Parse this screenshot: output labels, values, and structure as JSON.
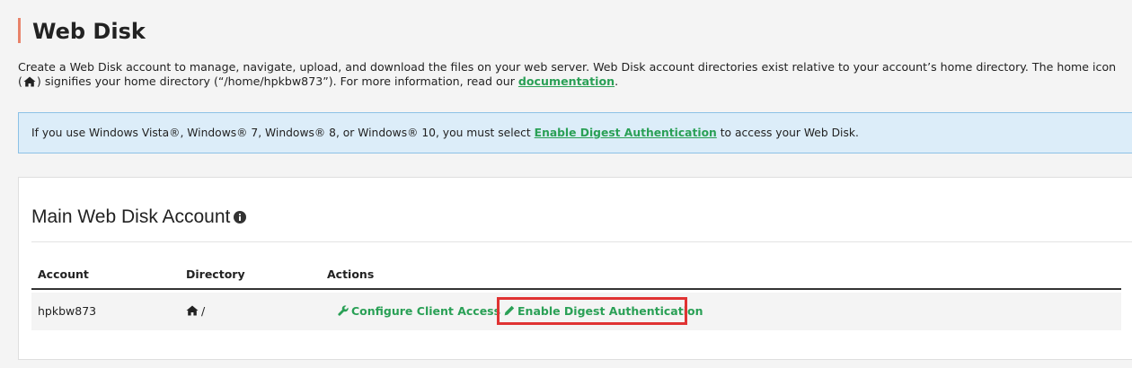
{
  "header": {
    "title": "Web Disk"
  },
  "intro": {
    "text_before_icon": "Create a Web Disk account to manage, navigate, upload, and download the files on your web server. Web Disk account directories exist relative to your account’s home directory. The home icon (",
    "text_after_icon": ") signifies your home directory (“/home/hpkbw873”). For more information, read our ",
    "link_label": "documentation",
    "text_end": "."
  },
  "alert": {
    "text_before": "If you use Windows Vista®, Windows® 7, Windows® 8, or Windows® 10, you must select ",
    "link_label": "Enable Digest Authentication",
    "text_after": " to access your Web Disk."
  },
  "main_account": {
    "heading": "Main Web Disk Account",
    "columns": [
      "Account",
      "Directory",
      "Actions"
    ],
    "row": {
      "account": "hpkbw873",
      "directory": "/",
      "actions": [
        "Configure Client Access",
        "Enable Digest Authentication"
      ]
    }
  },
  "colors": {
    "accent_green": "#2aa056",
    "title_bar": "#e8836a",
    "alert_bg": "#dcedf9",
    "highlight_red": "#e03333"
  },
  "icons": {
    "home": "home-icon",
    "info": "info-icon",
    "wrench": "wrench-icon",
    "pencil": "pencil-icon"
  }
}
